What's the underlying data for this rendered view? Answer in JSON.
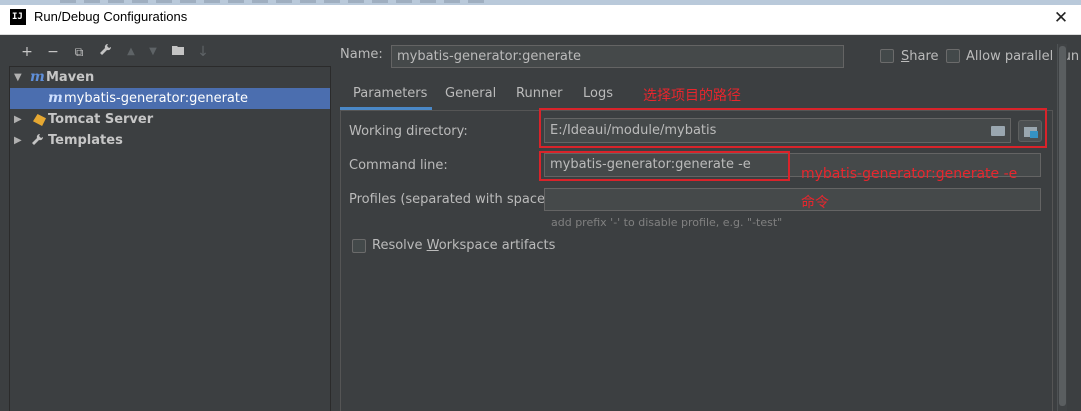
{
  "window": {
    "app_icon": "IJ",
    "title": "Run/Debug Configurations",
    "close_icon": "close-icon"
  },
  "toolbar": {
    "add": "+",
    "remove": "−",
    "copy": "⧉",
    "edit": "🔧",
    "up": "▲",
    "down": "▼",
    "folder": "▰",
    "sort": "↓"
  },
  "tree": {
    "maven_icon": "m",
    "maven": "Maven",
    "maven_child_icon": "m",
    "maven_child": "mybatis-generator:generate",
    "tomcat": "Tomcat Server",
    "templates": "Templates"
  },
  "name": {
    "label": "Name:",
    "value": "mybatis-generator:generate"
  },
  "options": {
    "share": "Share",
    "allow_parallel": "Allow parallel run"
  },
  "tabs": [
    "Parameters",
    "General",
    "Runner",
    "Logs"
  ],
  "form": {
    "working_dir_label": "Working directory:",
    "working_dir_value": "E:/Ideaui/module/mybatis",
    "command_line_label": "Command line:",
    "command_line_value": "mybatis-generator:generate -e",
    "profiles_label": "Profiles (separated with space):",
    "profiles_value": "",
    "profiles_hint": "add prefix '-' to disable profile, e.g. \"-test\"",
    "resolve_label": "Resolve Workspace artifacts"
  },
  "annotations": {
    "path_note": "选择项目的路径",
    "command_note_line1": "mybatis-generator:generate -e",
    "command_note_line2": "命令",
    "color": "#e8262d"
  },
  "colors": {
    "background": "#3c3f41",
    "selection": "#4b6eaf",
    "accent": "#4a88c7"
  }
}
